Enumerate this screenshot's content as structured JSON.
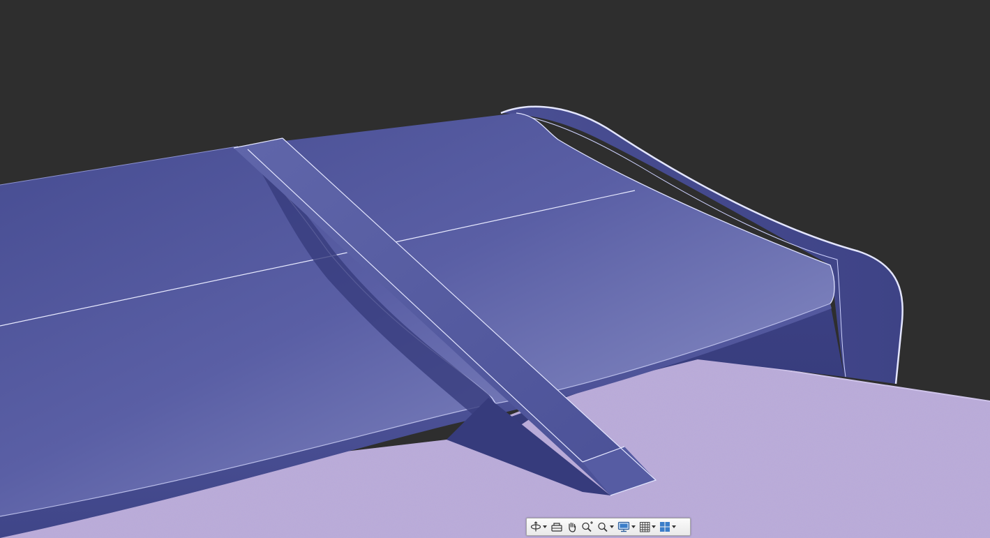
{
  "app": {
    "view": "3d-model-viewport"
  },
  "colors": {
    "background": "#2e2e2e",
    "wing": "#4a4f96",
    "wing_highlight": "#7d82bd",
    "edge_line": "#d8dcff",
    "body_surface": "#b7a8d8"
  },
  "nav_toolbar": {
    "tools": [
      {
        "id": "orbit",
        "icon": "orbit-icon",
        "has_dropdown": true
      },
      {
        "id": "full-navigation-wheel",
        "icon": "steering-wheel-icon",
        "has_dropdown": false
      },
      {
        "id": "pan",
        "icon": "pan-hand-icon",
        "has_dropdown": false
      },
      {
        "id": "zoom-realtime",
        "icon": "zoom-realtime-icon",
        "has_dropdown": false
      },
      {
        "id": "zoom-window",
        "icon": "zoom-window-icon",
        "has_dropdown": true
      },
      {
        "id": "display",
        "icon": "monitor-icon",
        "has_dropdown": true
      },
      {
        "id": "grid",
        "icon": "grid-icon",
        "has_dropdown": true
      },
      {
        "id": "viewports",
        "icon": "viewport-layout-icon",
        "has_dropdown": true
      }
    ]
  }
}
